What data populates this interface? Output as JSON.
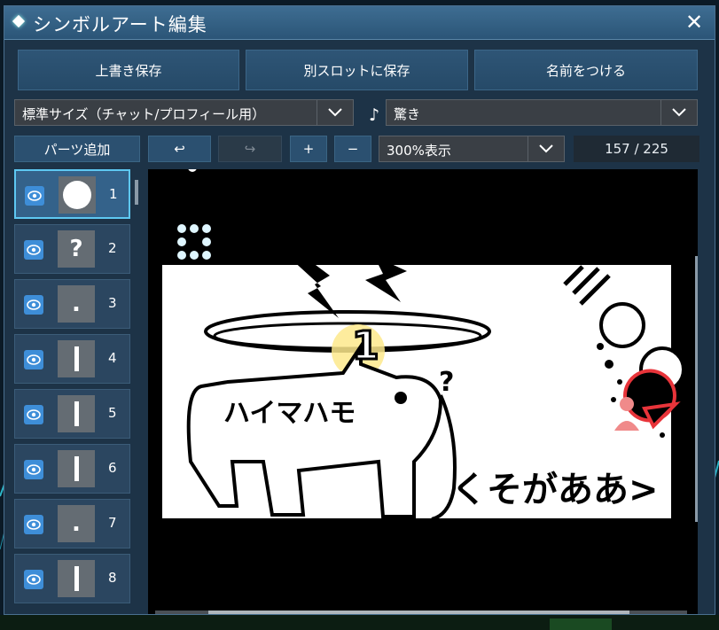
{
  "window": {
    "title": "シンボルアート編集",
    "close": "✕"
  },
  "toolbar": {
    "overwrite_save": "上書き保存",
    "save_other_slot": "別スロットに保存",
    "name_it": "名前をつける"
  },
  "size_select": {
    "value": "標準サイズ（チャット/プロフィール用）"
  },
  "sound": {
    "note": "♪",
    "value": "驚き"
  },
  "controls": {
    "add_parts": "パーツ追加",
    "undo": "↩",
    "redo": "↪",
    "zoom_in": "+",
    "zoom_out": "−",
    "zoom_value": "300%表示",
    "part_count": "157 / 225"
  },
  "parts": [
    {
      "num": "1",
      "thumb": "circle",
      "selected": true
    },
    {
      "num": "2",
      "thumb": "?"
    },
    {
      "num": "3",
      "thumb": "."
    },
    {
      "num": "4",
      "thumb": "|"
    },
    {
      "num": "5",
      "thumb": "|"
    },
    {
      "num": "6",
      "thumb": "|"
    },
    {
      "num": "7",
      "thumb": "."
    },
    {
      "num": "8",
      "thumb": "|"
    }
  ],
  "art": {
    "katakana": "ハイマハモ",
    "badge_number": "1",
    "question": "?",
    "shout": "くそがああ>"
  },
  "colors": {
    "accent": "#5ec8f2",
    "eye_icon": "#3e8ed8",
    "avatar_badge": "#e8343a"
  }
}
